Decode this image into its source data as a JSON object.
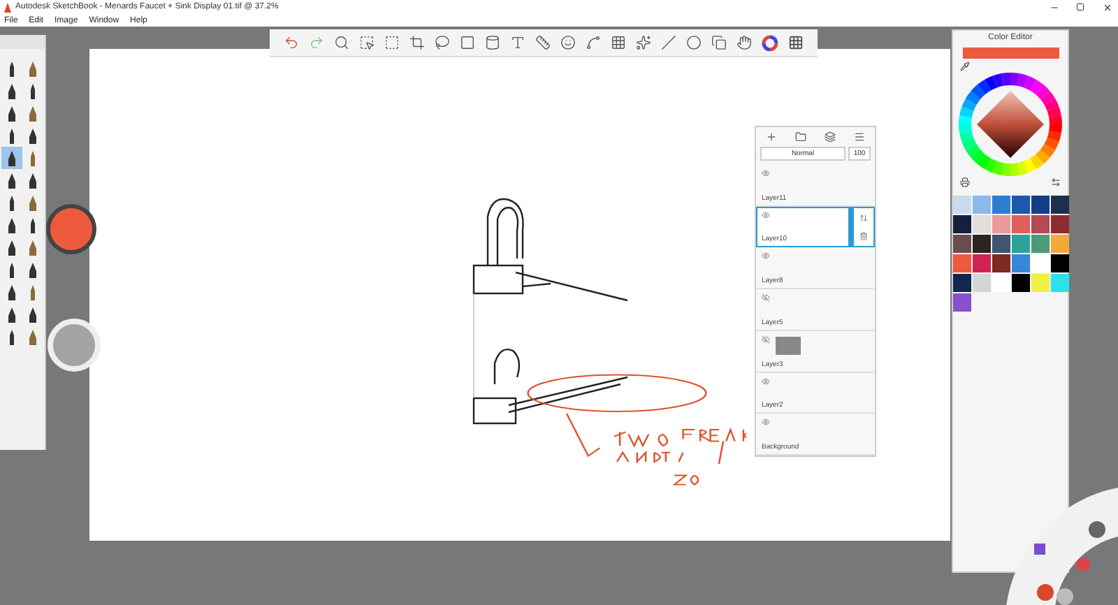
{
  "window": {
    "title": "Autodesk SketchBook - Menards Faucet + Sink Display 01.tif @ 37.2%"
  },
  "menu": [
    "File",
    "Edit",
    "Image",
    "Window",
    "Help"
  ],
  "brushes": [
    {
      "selected": false
    },
    {
      "selected": false
    },
    {
      "selected": false
    },
    {
      "selected": false
    },
    {
      "selected": false
    },
    {
      "selected": false
    },
    {
      "selected": false
    },
    {
      "selected": false
    },
    {
      "selected": true
    },
    {
      "selected": false
    },
    {
      "selected": false
    },
    {
      "selected": false
    },
    {
      "selected": false
    },
    {
      "selected": false
    },
    {
      "selected": false
    },
    {
      "selected": false
    },
    {
      "selected": false
    },
    {
      "selected": false
    },
    {
      "selected": false
    },
    {
      "selected": false
    },
    {
      "selected": false
    },
    {
      "selected": false
    },
    {
      "selected": false
    },
    {
      "selected": false
    },
    {
      "selected": false
    },
    {
      "selected": false
    }
  ],
  "layers_panel": {
    "blend_mode": "Normal",
    "opacity": "100",
    "layers": [
      {
        "name": "Layer11",
        "selected": false,
        "visible": true
      },
      {
        "name": "Layer10",
        "selected": true,
        "visible": true
      },
      {
        "name": "Layer8",
        "selected": false,
        "visible": true
      },
      {
        "name": "Layer5",
        "selected": false,
        "visible": false
      },
      {
        "name": "Layer3",
        "selected": false,
        "visible": false
      },
      {
        "name": "Layer2",
        "selected": false,
        "visible": true
      },
      {
        "name": "Background",
        "selected": false,
        "visible": true
      }
    ]
  },
  "color_editor": {
    "title": "Color Editor",
    "current": {
      "color": "#ee5a3c"
    },
    "swatches": [
      {
        "color": "#c9dcef"
      },
      {
        "color": "#8db8ea"
      },
      {
        "color": "#2a7fd0"
      },
      {
        "color": "#1c58ae"
      },
      {
        "color": "#123f8a"
      },
      {
        "color": "#1d2f4d"
      },
      {
        "color": "#13203f"
      },
      {
        "color": "#e5dcdc"
      },
      {
        "color": "#ec9a9e"
      },
      {
        "color": "#e1605f"
      },
      {
        "color": "#b54a55"
      },
      {
        "color": "#8f2c2e"
      },
      {
        "color": "#6a4d4c"
      },
      {
        "color": "#2b2421"
      },
      {
        "color": "#3f5570"
      },
      {
        "color": "#2ba39b"
      },
      {
        "color": "#4e9a78"
      },
      {
        "color": "#f2a93b"
      },
      {
        "color": "#ee5a3c"
      },
      {
        "color": "#cf2350"
      },
      {
        "color": "#7d2a22"
      },
      {
        "color": "#3a86d6"
      },
      {
        "color": "#ffffff"
      },
      {
        "color": "#000000"
      },
      {
        "color": "#132650"
      },
      {
        "color": "#d5d5d5"
      },
      {
        "color": "#ffffff"
      },
      {
        "color": "#000000"
      },
      {
        "color": "#eef042"
      },
      {
        "color": "#2ee0ee"
      },
      {
        "color": "#8a4fcc"
      }
    ]
  }
}
